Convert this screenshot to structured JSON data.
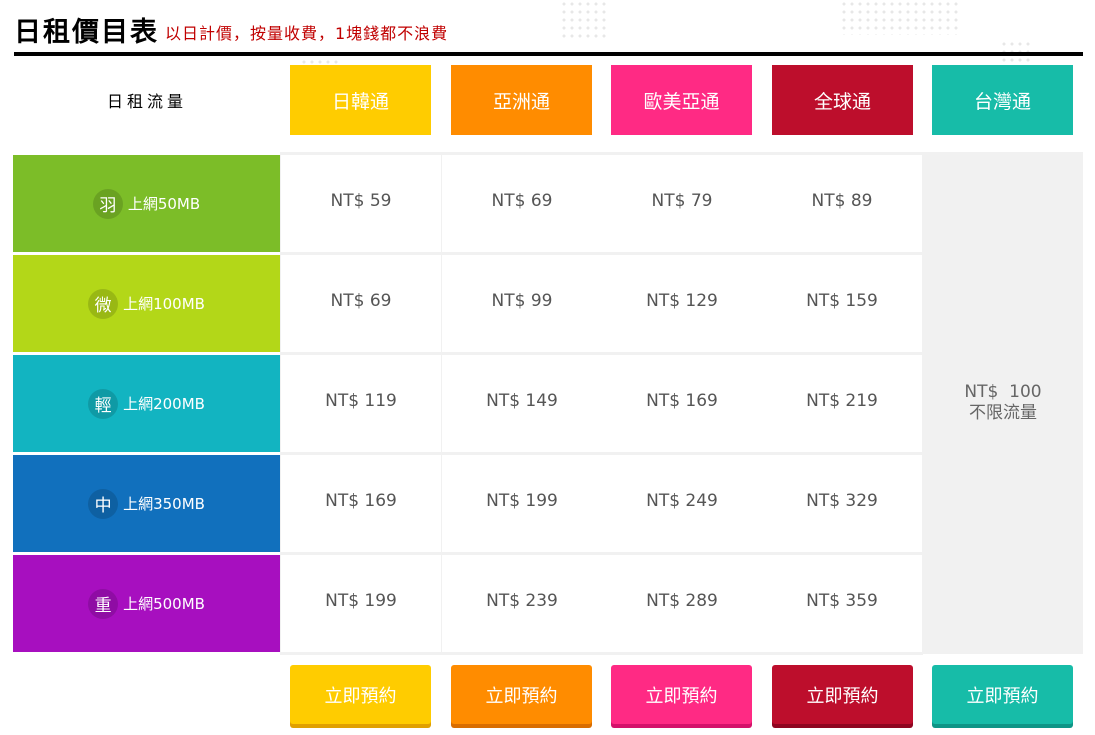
{
  "header": {
    "title": "日租價目表",
    "subtitle": "以日計價，按量收費，1塊錢都不浪費"
  },
  "table": {
    "corner_label": "日租流量",
    "columns": [
      {
        "label": "日韓通",
        "color": "#ffcc00",
        "button_shadow": "#e0a000"
      },
      {
        "label": "亞洲通",
        "color": "#ff8c00",
        "button_shadow": "#d96d00"
      },
      {
        "label": "歐美亞通",
        "color": "#ff2a84",
        "button_shadow": "#d4116a"
      },
      {
        "label": "全球通",
        "color": "#bd0e2c",
        "button_shadow": "#8f0520"
      },
      {
        "label": "台灣通",
        "color": "#17bca8",
        "button_shadow": "#0e9586"
      }
    ],
    "plans": [
      {
        "badge": "羽",
        "label": "上網50MB",
        "color": "#7cbd28",
        "prices": [
          "NT$ 59",
          "NT$ 69",
          "NT$ 79",
          "NT$ 89"
        ]
      },
      {
        "badge": "微",
        "label": "上網100MB",
        "color": "#b3d718",
        "prices": [
          "NT$ 69",
          "NT$ 99",
          "NT$ 129",
          "NT$ 159"
        ]
      },
      {
        "badge": "輕",
        "label": "上網200MB",
        "color": "#12b4c1",
        "prices": [
          "NT$ 119",
          "NT$ 149",
          "NT$ 169",
          "NT$ 219"
        ]
      },
      {
        "badge": "中",
        "label": "上網350MB",
        "color": "#1170bd",
        "prices": [
          "NT$ 169",
          "NT$ 199",
          "NT$ 249",
          "NT$ 329"
        ]
      },
      {
        "badge": "重",
        "label": "上網500MB",
        "color": "#a70fbf",
        "prices": [
          "NT$ 199",
          "NT$ 239",
          "NT$ 289",
          "NT$ 359"
        ]
      }
    ],
    "unlimited": {
      "price": "NT$  100",
      "note": "不限流量"
    },
    "book_label": "立即預約"
  }
}
